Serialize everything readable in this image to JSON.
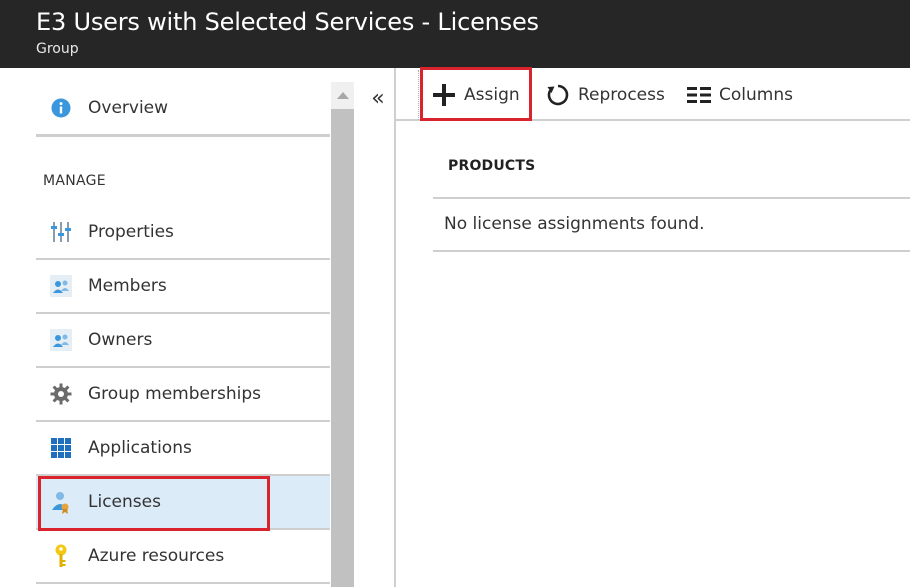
{
  "header": {
    "title": "E3 Users with Selected Services - Licenses",
    "subtitle": "Group"
  },
  "sidebar": {
    "overview": {
      "label": "Overview",
      "icon": "info-icon"
    },
    "section_label": "MANAGE",
    "items": [
      {
        "label": "Properties",
        "icon": "properties-icon"
      },
      {
        "label": "Members",
        "icon": "members-icon"
      },
      {
        "label": "Owners",
        "icon": "owners-icon"
      },
      {
        "label": "Group memberships",
        "icon": "gear-icon"
      },
      {
        "label": "Applications",
        "icon": "applications-grid-icon"
      },
      {
        "label": "Licenses",
        "icon": "licenses-icon",
        "selected": true
      },
      {
        "label": "Azure resources",
        "icon": "key-icon"
      }
    ],
    "collapse_glyph": "«"
  },
  "toolbar": {
    "assign_label": "Assign",
    "reprocess_label": "Reprocess",
    "columns_label": "Columns"
  },
  "content": {
    "column_header": "PRODUCTS",
    "empty_message": "No license assignments found."
  },
  "colors": {
    "header_bg": "#262626",
    "selected_bg": "#dcebf8",
    "highlight_border": "#d9232d",
    "accent_blue": "#0078d4"
  }
}
